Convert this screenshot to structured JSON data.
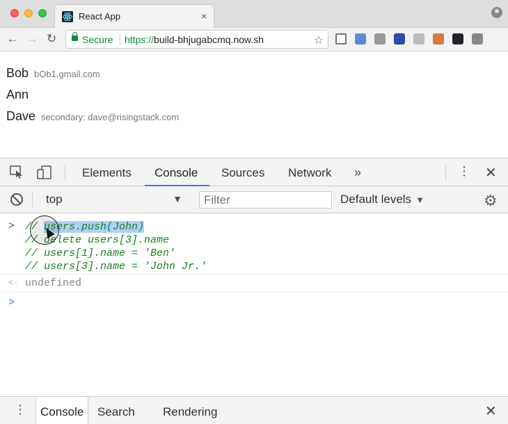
{
  "browser": {
    "tab_title": "React App",
    "tab_close": "×",
    "secure_label": "Secure",
    "url_scheme": "https://",
    "url_host": "build-bhjugabcmq.now.sh",
    "icons": [
      "react-favicon-icon",
      "lock-icon",
      "star-icon",
      "cast-icon",
      "profile-icon"
    ]
  },
  "page": {
    "users": [
      {
        "name": "Bob",
        "detail": "bOb1.gmail.com"
      },
      {
        "name": "Ann",
        "detail": ""
      },
      {
        "name": "Dave",
        "detail": "secondary: dave@risingstack.com"
      }
    ]
  },
  "devtools": {
    "tabs": [
      "Elements",
      "Console",
      "Sources",
      "Network"
    ],
    "active_tab": "Console",
    "more": "»",
    "close": "✕",
    "context": "top",
    "filter_placeholder": "Filter",
    "levels": "Default levels",
    "console": {
      "input_prompt": ">",
      "result_prompt": "<·",
      "lines": [
        {
          "prefix": "// ",
          "highlight": "users.push(John)"
        },
        {
          "prefix": "// delete users[3].name",
          "highlight": ""
        },
        {
          "prefix": "// users[1].name = 'Ben'",
          "highlight": ""
        },
        {
          "prefix": "// users[3].name = 'John Jr.'",
          "highlight": ""
        }
      ],
      "result": "undefined",
      "empty_prompt": ">"
    },
    "drawer": {
      "tabs": [
        "Console",
        "Search",
        "Rendering"
      ],
      "active": "Console",
      "close": "✕"
    }
  },
  "colors": {
    "accent": "#3879d9",
    "secure_green": "#0a8a3c",
    "code_green": "#1e7f1e",
    "selection": "#aed0f6"
  }
}
